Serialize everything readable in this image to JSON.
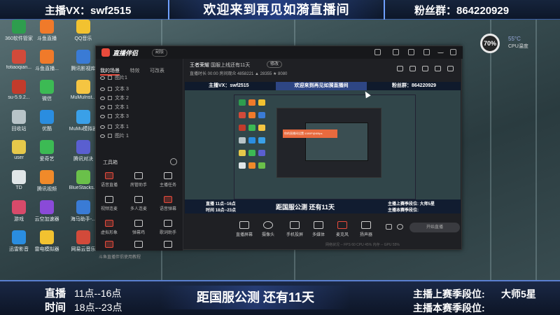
{
  "overlay": {
    "top_left": "主播VX：swf2515",
    "top_title": "欢迎来到再见如漪直播间",
    "top_right": "粉丝群：864220929",
    "live_label": "直播",
    "live_hours": "11点--16点",
    "time_label": "时间",
    "time_hours": "18点--23点",
    "countdown": "距国服公测  还有11天",
    "rank_prev_label": "主播上赛季段位:",
    "rank_prev_value": "大师5星",
    "rank_curr_label": "主播本赛季段位:"
  },
  "desktop_icons": [
    {
      "label": "360软件管家",
      "color": "#2e9d4e"
    },
    {
      "label": "斗鱼直播",
      "color": "#f07a2a"
    },
    {
      "label": "QQ音乐",
      "color": "#f2c230"
    },
    {
      "label": "fotiaoqian...",
      "color": "#d24a3a"
    },
    {
      "label": "斗鱼直播...",
      "color": "#f07a2a"
    },
    {
      "label": "腾讯影视库",
      "color": "#3a7bd5"
    },
    {
      "label": "su-5.9.2...",
      "color": "#c23b2b"
    },
    {
      "label": "微信",
      "color": "#3cba54"
    },
    {
      "label": "MuMuInst...",
      "color": "#f5c542"
    },
    {
      "label": "回收站",
      "color": "#b8c4c8"
    },
    {
      "label": "优酷",
      "color": "#2a8de0"
    },
    {
      "label": "MuMu模拟器",
      "color": "#3aa0e8"
    },
    {
      "label": "user",
      "color": "#e6c84a"
    },
    {
      "label": "爱奇艺",
      "color": "#3cba54"
    },
    {
      "label": "腾讯对决",
      "color": "#5a5fd0"
    },
    {
      "label": "TD",
      "color": "#e0e6e8"
    },
    {
      "label": "腾讯视频",
      "color": "#f08a2a"
    },
    {
      "label": "BlueStacks...",
      "color": "#6ac04a"
    },
    {
      "label": "游戏",
      "color": "#d84a6a"
    },
    {
      "label": "云空加速器",
      "color": "#8a4ad8"
    },
    {
      "label": "海马助手-...",
      "color": "#3a7bd5"
    },
    {
      "label": "迅雷影音",
      "color": "#2a8de0"
    },
    {
      "label": "雷电模拟器",
      "color": "#f2c230"
    },
    {
      "label": "网易云音乐",
      "color": "#d24a3a"
    }
  ],
  "cpu_widget": {
    "percent": "70%",
    "temp": "55°C",
    "label": "CPU温度"
  },
  "app": {
    "name": "直播伴侣",
    "badge": "副版",
    "tabs": [
      "我的场景",
      "特效",
      "可改表"
    ],
    "sources": [
      "图片1",
      "文本 3",
      "文本 2",
      "文本 1",
      "文本 3",
      "文本 1",
      "图片 1"
    ],
    "tools_title": "工具箱",
    "tools": [
      "语音直播",
      "房管助手",
      "主播任务",
      "视频连麦",
      "多人连麦",
      "语音弹幕",
      "虚拟形象",
      "弹幕鸡",
      "歌词助手",
      "PK",
      "房间规则",
      "更多"
    ],
    "side_note": "斗鱼直播伴侣使用教程",
    "live_title_prefix": "王者荣耀",
    "live_title": "国服上线还有11天",
    "edit_label": "修改",
    "live_stats": "直播时长 00:00  房间观众 4858221  ▲ 28355  ★ 8080",
    "controls": [
      "直播屏幕",
      "摄像头",
      "手机投屏",
      "多媒体",
      "麦克风",
      "扬声器"
    ],
    "start_label": "开始直播",
    "status_bar": "网络状况 --   FPS 60   CPU 45%   内存 --   GPU 55%"
  },
  "preview": {
    "top_left": "主播VX：swf2515",
    "top_title": "欢迎来到再见如漪直播间",
    "top_right": "粉丝群：864220929",
    "bot_left_1": "直播  11点--16点",
    "bot_left_2": "时间  18点--23点",
    "bot_center": "距国服公测  还有11天",
    "bot_right_1": "主播上赛季段位:  大师5星",
    "bot_right_2": "主播本赛季段位:",
    "alert": "你的直播间设置:1080P@60fps"
  }
}
